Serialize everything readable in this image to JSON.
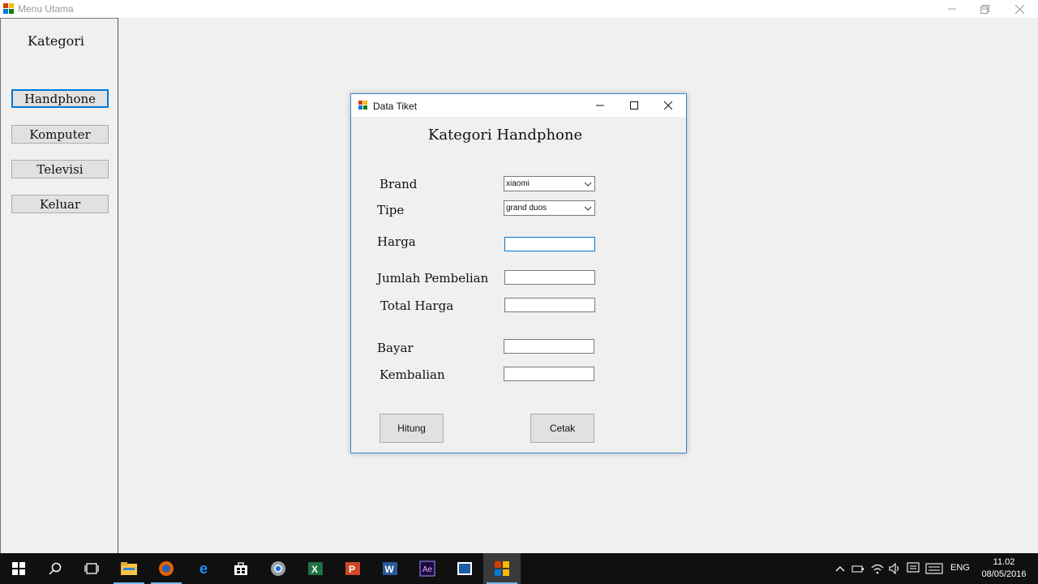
{
  "main_window": {
    "title": "Menu Utama"
  },
  "sidebar": {
    "heading": "Kategori",
    "items": [
      {
        "label": "Handphone",
        "active": true
      },
      {
        "label": "Komputer",
        "active": false
      },
      {
        "label": "Televisi",
        "active": false
      },
      {
        "label": "Keluar",
        "active": false
      }
    ]
  },
  "dialog": {
    "title": "Data Tiket",
    "heading": "Kategori Handphone",
    "fields": {
      "brand": {
        "label": "Brand",
        "value": "xiaomi"
      },
      "tipe": {
        "label": "Tipe",
        "value": "grand duos"
      },
      "harga": {
        "label": "Harga",
        "value": ""
      },
      "jumlah": {
        "label": "Jumlah Pembelian",
        "value": ""
      },
      "total": {
        "label": "Total Harga",
        "value": ""
      },
      "bayar": {
        "label": "Bayar",
        "value": ""
      },
      "kembalian": {
        "label": "Kembalian",
        "value": ""
      }
    },
    "buttons": {
      "hitung": "Hitung",
      "cetak": "Cetak"
    }
  },
  "taskbar": {
    "apps": [
      "start-icon",
      "search-icon",
      "task-view-icon",
      "file-explorer-icon",
      "firefox-icon",
      "edge-icon",
      "store-icon",
      "chrome-icon",
      "excel-icon",
      "powerpoint-icon",
      "word-icon",
      "after-effects-icon",
      "visual-studio-icon",
      "app-window-icon"
    ],
    "language": "ENG",
    "time": "11.02",
    "date": "08/05/2016"
  },
  "colors": {
    "accent": "#0078d7",
    "taskbar": "#101010",
    "background": "#f0f0f0"
  }
}
